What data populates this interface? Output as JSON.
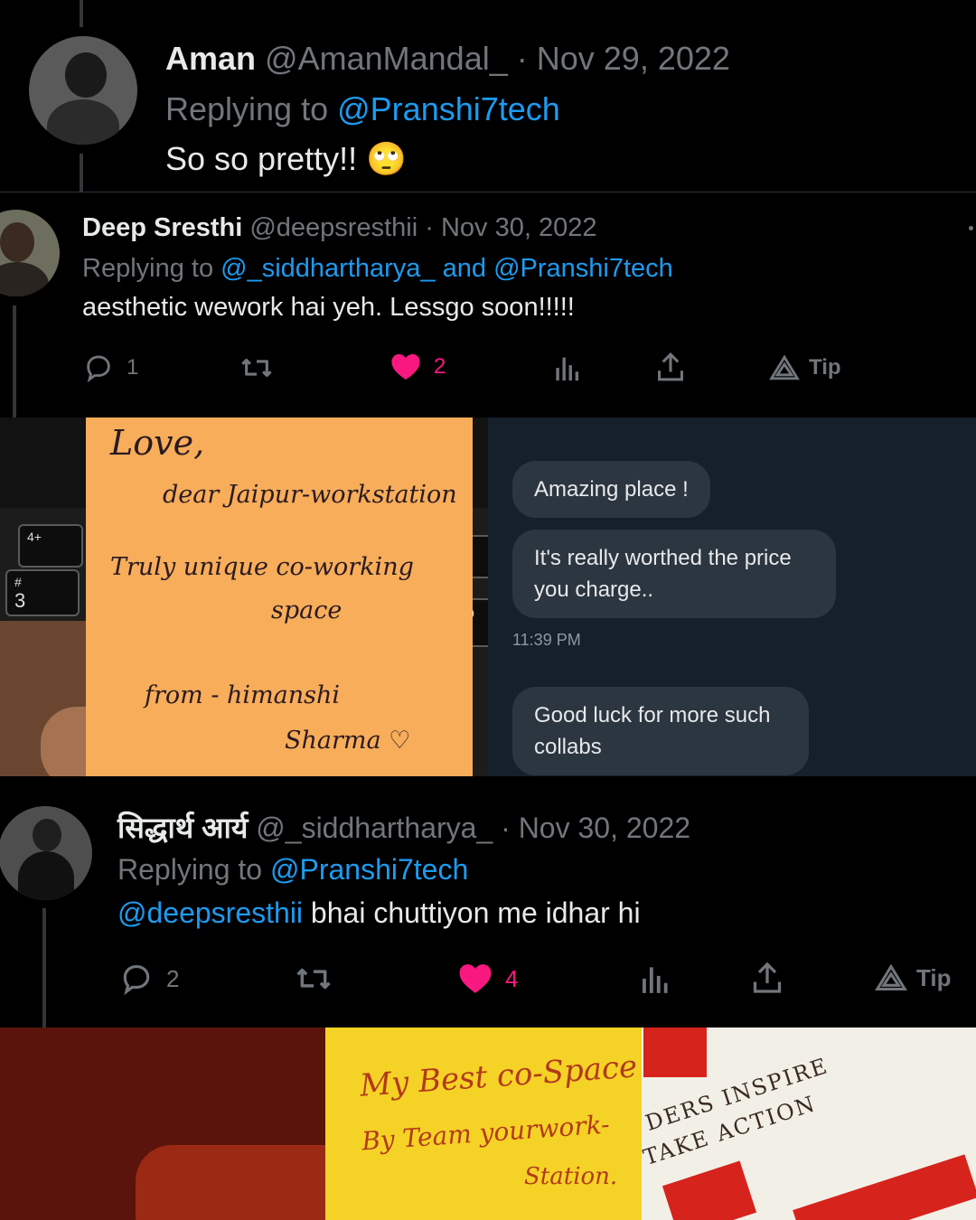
{
  "tweet1": {
    "name": "Aman",
    "handle": "@AmanMandal_",
    "date_sep": "·",
    "date": "Nov 29, 2022",
    "replying_label": "Replying to",
    "replying_to": "@Pranshi7tech",
    "text": "So so pretty!!",
    "emoji": "🙄"
  },
  "tweet2": {
    "name": "Deep Sresthi",
    "handle": "@deepsresthii",
    "date_sep": "·",
    "date": "Nov 30, 2022",
    "replying_label": "Replying to",
    "replying_to": "@_siddhartharya_ and @Pranshi7tech",
    "text": "aesthetic wework hai yeh. Lessgo soon!!!!!",
    "replies": "1",
    "likes": "2",
    "tip_label": "Tip"
  },
  "note1": {
    "line1": "Love,",
    "line2": "dear Jaipur-workstation",
    "line3": "Truly unique co-working",
    "line4": "space",
    "line5": "from - himanshi",
    "line6": "Sharma ♡",
    "key_label": "3",
    "key_label2": "4+",
    "key_label3": "#"
  },
  "chat": {
    "messages": [
      "Amazing place !",
      "It's really worthed the price you charge..",
      "Good luck for more such collabs"
    ],
    "time": "11:39 PM"
  },
  "tweet3": {
    "name": "सिद्धार्थ आर्य",
    "handle": "@_siddhartharya_",
    "date_sep": "·",
    "date": "Nov 30, 2022",
    "replying_label": "Replying to",
    "replying_to": "@Pranshi7tech",
    "mention": "@deepsresthii",
    "text": "bhai chuttiyon me idhar hi",
    "replies": "2",
    "likes": "4",
    "tip_label": "Tip"
  },
  "note2": {
    "line1": "My Best co-Space",
    "line2": "By Team yourwork-",
    "line3": "Station.",
    "book_text1": "DERS INSPIRE",
    "book_text2": "TAKE ACTION"
  },
  "colors": {
    "link": "#1d9bf0",
    "like": "#f91880",
    "muted": "#71767b",
    "sticky_orange": "#f7ad5a",
    "sticky_yellow": "#f5d226"
  }
}
